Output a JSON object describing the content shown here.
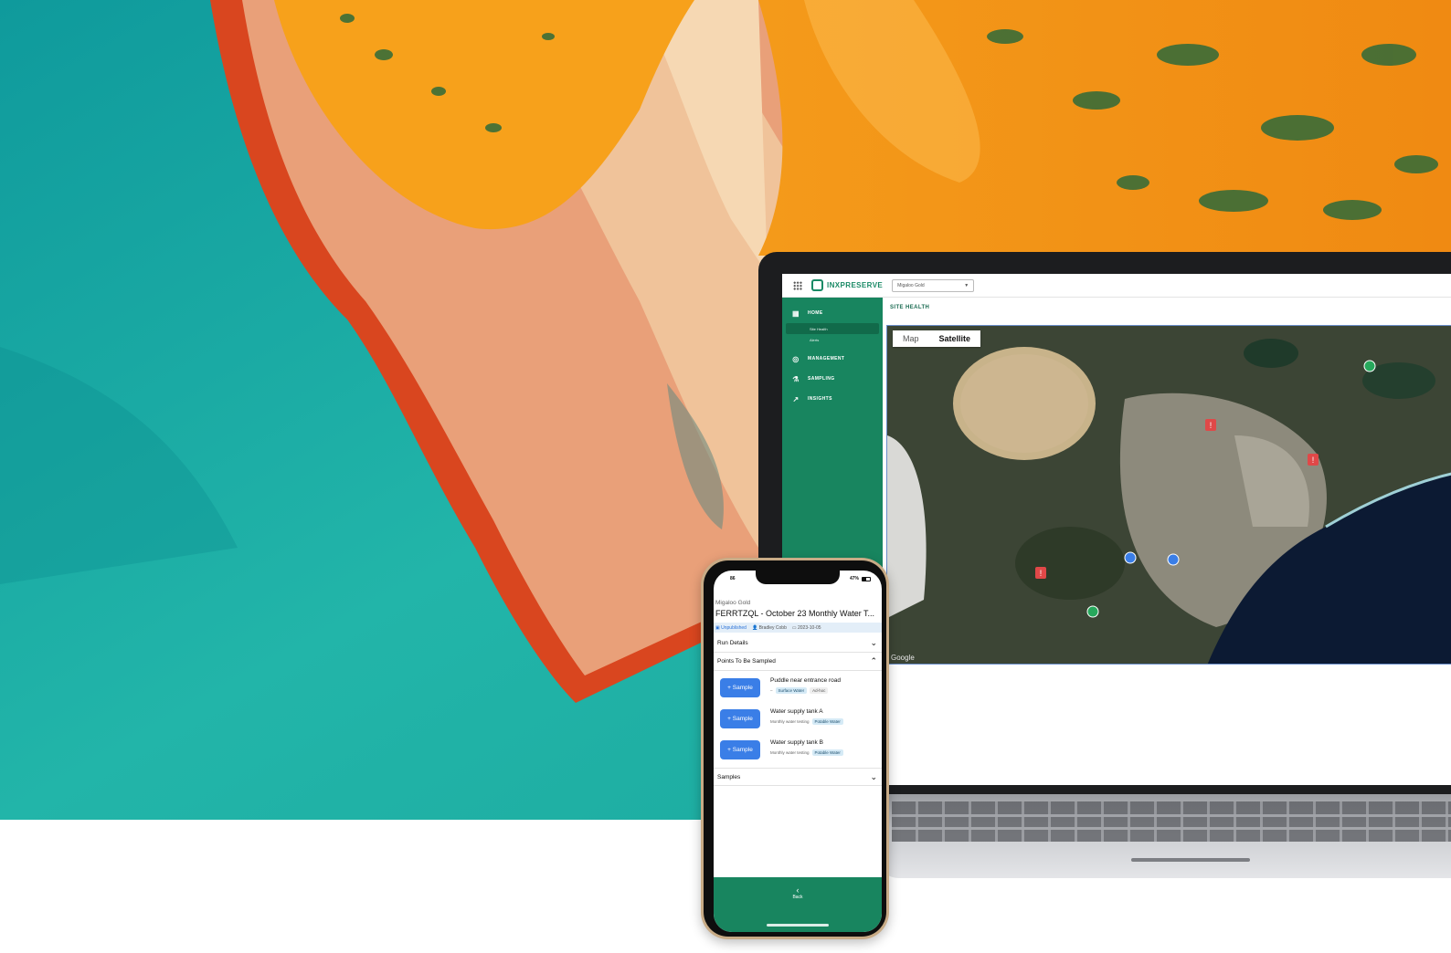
{
  "laptop": {
    "brand": "INXPRESERVE",
    "org_select": "Migaloo Gold",
    "nav": {
      "home": "HOME",
      "site_health": "Site Health",
      "alerts": "Alerts",
      "management": "MANAGEMENT",
      "sampling": "SAMPLING",
      "insights": "INSIGHTS"
    },
    "page_title": "SITE HEALTH",
    "map": {
      "tab_map": "Map",
      "tab_satellite": "Satellite",
      "active_tab": "Satellite",
      "attribution": "Google"
    }
  },
  "phone": {
    "status": {
      "left": "86",
      "battery": "47%"
    },
    "org": "Migaloo Gold",
    "title": "FERRTZQL - October 23 Monthly Water T...",
    "meta": {
      "status": "Unpublished",
      "user": "Bradley Cobb",
      "date": "2023-10-05"
    },
    "sections": {
      "run_details": "Run Details",
      "points": "Points To Be Sampled",
      "samples": "Samples"
    },
    "sample_button": "+ Sample",
    "points": [
      {
        "name": "Puddle near entrance road",
        "prefix": "–",
        "tags": [
          "Surface Water",
          "Ad-hoc"
        ]
      },
      {
        "name": "Water supply tank A",
        "prefix": "Monthly water testing",
        "tags": [
          "Potable Water"
        ]
      },
      {
        "name": "Water supply tank B",
        "prefix": "Monthly water testing",
        "tags": [
          "Potable Water"
        ]
      }
    ],
    "footer": {
      "back": "Back"
    }
  },
  "colors": {
    "brand_green": "#18855f",
    "button_blue": "#3a7ee7",
    "tag_blue": "#d5eaf6",
    "alert_red": "#e04848"
  }
}
